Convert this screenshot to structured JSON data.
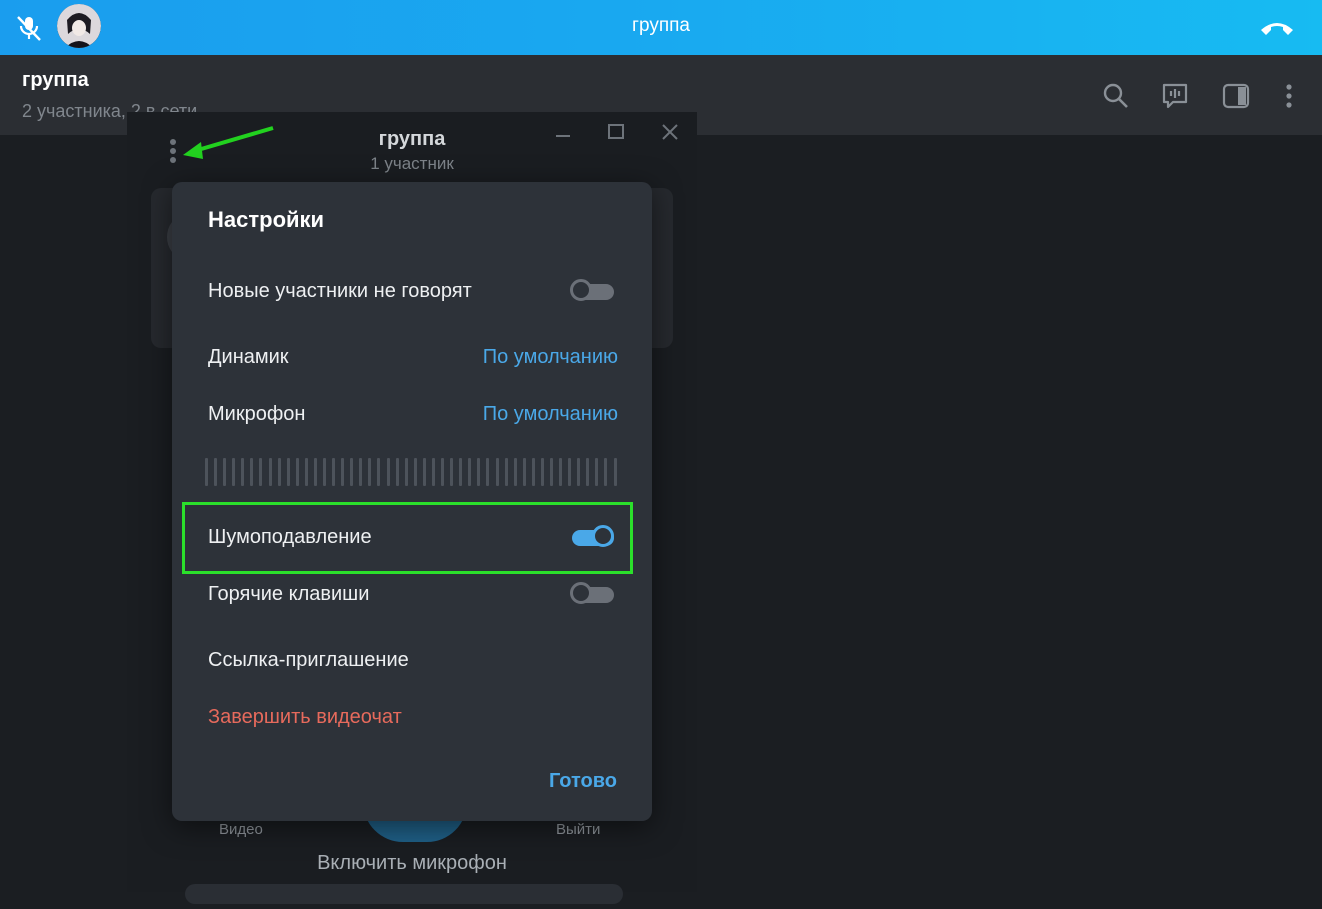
{
  "topbar": {
    "title": "группа",
    "icons": [
      "mic-off-icon",
      "avatar",
      "hangup-icon"
    ],
    "color": "#1a9dee"
  },
  "chat_header": {
    "name": "группа",
    "subtitle": "2 участника, 2 в сети",
    "icons": [
      "search-icon",
      "voice-chat-icon",
      "sidebar-icon",
      "more-icon"
    ]
  },
  "voice_window": {
    "title": "группа",
    "subtitle": "1 участник",
    "video_label": "Видео",
    "exit_label": "Выйти",
    "enable_mic": "Включить микрофон"
  },
  "settings": {
    "title": "Настройки",
    "new_participants_label": "Новые участники не говорят",
    "new_participants_on": false,
    "speaker_label": "Динамик",
    "speaker_value": "По умолчанию",
    "mic_label": "Микрофон",
    "mic_value": "По умолчанию",
    "noise_label": "Шумоподавление",
    "noise_on": true,
    "hotkeys_label": "Горячие клавиши",
    "hotkeys_on": false,
    "invite_label": "Ссылка-приглашение",
    "end_label": "Завершить видеочат",
    "done_label": "Готово"
  },
  "colors": {
    "accent": "#4aa8e8",
    "danger": "#e76a5c",
    "highlight": "#2be02b",
    "modal_bg": "#2d3239"
  }
}
